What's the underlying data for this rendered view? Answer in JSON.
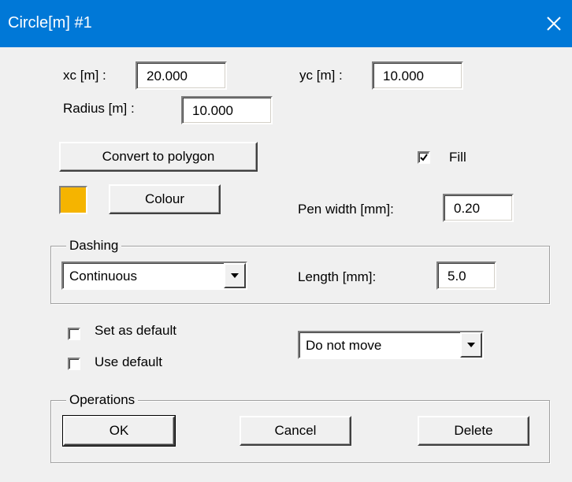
{
  "window": {
    "title": "Circle[m]  #1"
  },
  "geometry": {
    "xc_label": "xc [m] :",
    "xc_value": "20.000",
    "yc_label": "yc [m] :",
    "yc_value": "10.000",
    "radius_label": "Radius [m] :",
    "radius_value": "10.000"
  },
  "buttons": {
    "convert": "Convert to polygon",
    "colour": "Colour",
    "ok": "OK",
    "cancel": "Cancel",
    "delete": "Delete"
  },
  "fill": {
    "label": "Fill",
    "checked": true
  },
  "colour": {
    "swatch_color": "#f5b400"
  },
  "pen": {
    "label": "Pen width [mm]:",
    "value": "0.20"
  },
  "dashing": {
    "group_title": "Dashing",
    "style_value": "Continuous",
    "length_label": "Length [mm]:",
    "length_value": "5.0"
  },
  "defaults": {
    "set_as_default_label": "Set as default",
    "set_as_default_checked": false,
    "use_default_label": "Use default",
    "use_default_checked": false
  },
  "move": {
    "value": "Do not move"
  },
  "operations": {
    "group_title": "Operations"
  },
  "colors": {
    "title_bar": "#0078d7",
    "dialog_bg": "#f0f0f0"
  }
}
